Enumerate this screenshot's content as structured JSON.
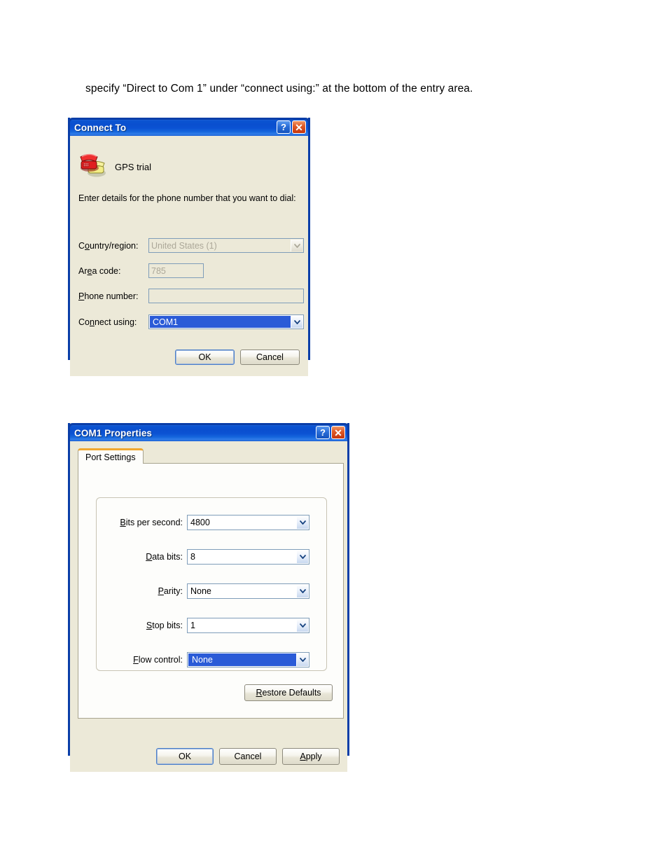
{
  "page": {
    "body_text": "specify “Direct to Com 1” under “connect using:” at the bottom of the entry area."
  },
  "connect_dialog": {
    "title": "Connect To",
    "help_glyph": "?",
    "close_glyph": "✕",
    "icon_name": "telephone-icon",
    "connection_name": "GPS trial",
    "intro": "Enter details for the phone number that you want to dial:",
    "fields": [
      {
        "name": "country-region",
        "label_pre": "C",
        "label_accel": "o",
        "label_post": "untry/region:",
        "value": "United States (1)",
        "type": "combo",
        "disabled": true,
        "focused": false
      },
      {
        "name": "area-code",
        "label_pre": "Ar",
        "label_accel": "e",
        "label_post": "a code:",
        "value": "785",
        "type": "input",
        "disabled": true,
        "focused": false
      },
      {
        "name": "phone-number",
        "label_pre": "",
        "label_accel": "P",
        "label_post": "hone number:",
        "value": "",
        "type": "input",
        "disabled": false,
        "focused": false
      },
      {
        "name": "connect-using",
        "label_pre": "Co",
        "label_accel": "n",
        "label_post": "nect using:",
        "value": "COM1",
        "type": "combo",
        "disabled": false,
        "focused": true
      }
    ],
    "buttons": {
      "ok": "OK",
      "cancel": "Cancel"
    }
  },
  "com1_dialog": {
    "title": "COM1 Properties",
    "help_glyph": "?",
    "close_glyph": "✕",
    "tab": "Port Settings",
    "fields": [
      {
        "name": "bits-per-second",
        "label_accel": "B",
        "label_rest": "its per second:",
        "value": "4800"
      },
      {
        "name": "data-bits",
        "label_accel": "D",
        "label_rest": "ata bits:",
        "value": "8"
      },
      {
        "name": "parity",
        "label_accel": "P",
        "label_rest": "arity:",
        "value": "None"
      },
      {
        "name": "stop-bits",
        "label_accel": "S",
        "label_rest": "top bits:",
        "value": "1"
      },
      {
        "name": "flow-control",
        "label_accel": "F",
        "label_rest": "low control:",
        "value": "None",
        "focused": true
      }
    ],
    "restore_defaults": {
      "accel": "R",
      "rest": "estore Defaults"
    },
    "buttons": {
      "ok": "OK",
      "cancel": "Cancel",
      "apply_accel": "A",
      "apply_rest": "pply"
    }
  },
  "colors": {
    "titlebar_blue": "#0a53d1",
    "dialog_face": "#ece9d8",
    "selection_blue": "#2a5bd7",
    "tab_accent": "#f0a830",
    "close_red": "#c4350d"
  }
}
